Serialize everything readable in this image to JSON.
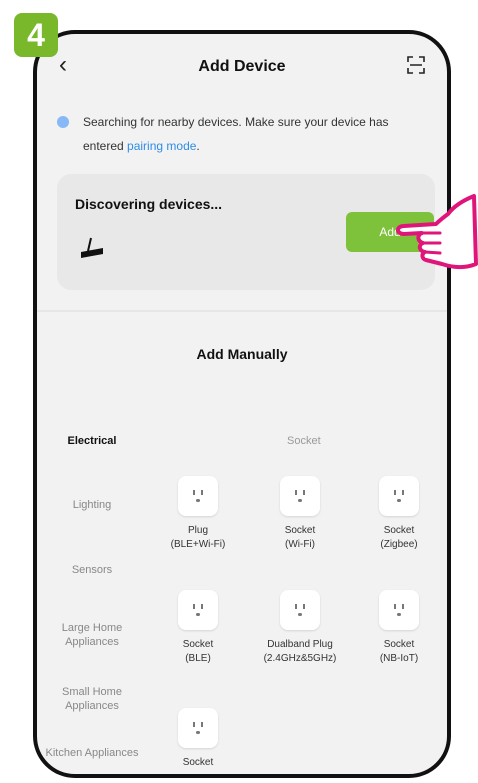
{
  "step_number": "4",
  "header": {
    "title": "Add Device"
  },
  "notice": {
    "text": "Searching for nearby devices. Make sure your device has entered ",
    "link": "pairing mode",
    "suffix": "."
  },
  "discover": {
    "title": "Discovering devices...",
    "button_label": "Add"
  },
  "manual": {
    "title": "Add Manually"
  },
  "categories": [
    {
      "label": "Electrical",
      "active": true
    },
    {
      "label": "Lighting"
    },
    {
      "label": "Sensors"
    },
    {
      "label": "Large Home Appliances"
    },
    {
      "label": "Small Home Appliances"
    },
    {
      "label": "Kitchen Appliances"
    }
  ],
  "section": {
    "header": "Socket"
  },
  "devices": [
    {
      "name": "Plug",
      "sub": "(BLE+Wi-Fi)"
    },
    {
      "name": "Socket",
      "sub": "(Wi-Fi)"
    },
    {
      "name": "Socket",
      "sub": "(Zigbee)"
    },
    {
      "name": "Socket",
      "sub": "(BLE)"
    },
    {
      "name": "Dualband Plug",
      "sub": "(2.4GHz&5GHz)"
    },
    {
      "name": "Socket",
      "sub": "(NB-IoT)"
    },
    {
      "name": "Socket",
      "sub": ""
    }
  ],
  "colors": {
    "accent_green": "#7dc23a",
    "badge_green": "#78b82a",
    "link_blue": "#2e8de8",
    "hand_outline": "#e0157a"
  },
  "icons": [
    "back-icon",
    "scan-icon",
    "searching-dot-icon",
    "router-device-icon",
    "socket-icon",
    "pointing-hand-icon"
  ]
}
